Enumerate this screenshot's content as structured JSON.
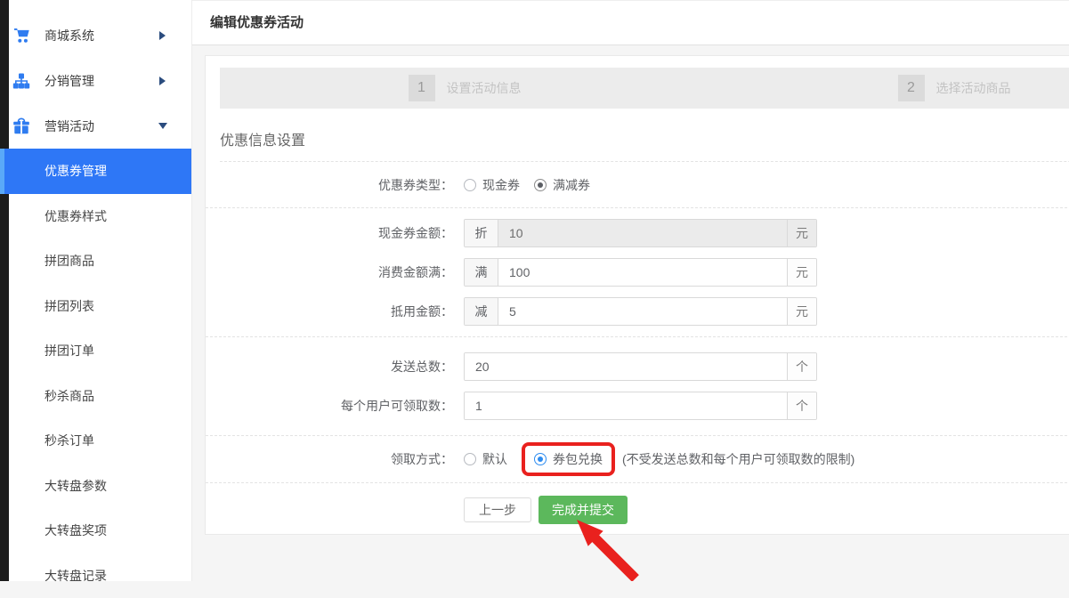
{
  "page": {
    "title": "编辑优惠券活动"
  },
  "sidebar": {
    "menu": [
      {
        "label": "商城系统",
        "icon": "cart-icon"
      },
      {
        "label": "分销管理",
        "icon": "sitemap-icon"
      },
      {
        "label": "营销活动",
        "icon": "gift-icon"
      }
    ],
    "submenu": [
      {
        "label": "优惠券管理",
        "active": true
      },
      {
        "label": "优惠券样式",
        "active": false
      },
      {
        "label": "拼团商品",
        "active": false
      },
      {
        "label": "拼团列表",
        "active": false
      },
      {
        "label": "拼团订单",
        "active": false
      },
      {
        "label": "秒杀商品",
        "active": false
      },
      {
        "label": "秒杀订单",
        "active": false
      },
      {
        "label": "大转盘参数",
        "active": false
      },
      {
        "label": "大转盘奖项",
        "active": false
      },
      {
        "label": "大转盘记录",
        "active": false
      }
    ]
  },
  "steps": [
    {
      "num": "1",
      "label": "设置活动信息"
    },
    {
      "num": "2",
      "label": "选择活动商品"
    }
  ],
  "form": {
    "section_title": "优惠信息设置",
    "coupon_type": {
      "label": "优惠券类型：",
      "options": [
        {
          "label": "现金券",
          "checked": false
        },
        {
          "label": "满减券",
          "checked": true
        }
      ]
    },
    "cash_amount": {
      "label": "现金券金额：",
      "prefix": "折",
      "value": "10",
      "suffix": "元",
      "disabled": true
    },
    "spend_threshold": {
      "label": "消费金额满：",
      "prefix": "满",
      "value": "100",
      "suffix": "元",
      "disabled": false
    },
    "deduct_amount": {
      "label": "抵用金额：",
      "prefix": "减",
      "value": "5",
      "suffix": "元",
      "disabled": false
    },
    "send_total": {
      "label": "发送总数：",
      "value": "20",
      "suffix": "个"
    },
    "per_user_limit": {
      "label": "每个用户可领取数：",
      "value": "1",
      "suffix": "个"
    },
    "receive_method": {
      "label": "领取方式：",
      "options": [
        {
          "label": "默认",
          "checked": false
        },
        {
          "label": "券包兑换",
          "checked": true
        }
      ],
      "hint": "(不受发送总数和每个用户可领取数的限制)"
    },
    "buttons": {
      "prev": "上一步",
      "submit": "完成并提交"
    }
  },
  "colors": {
    "active_item_blue": "#2e77f6",
    "active_item_strip": "#5aa9f8",
    "icon_blue": "#2f7cf0",
    "submit_green": "#5cb85c",
    "annotation_red": "#e9211e"
  }
}
